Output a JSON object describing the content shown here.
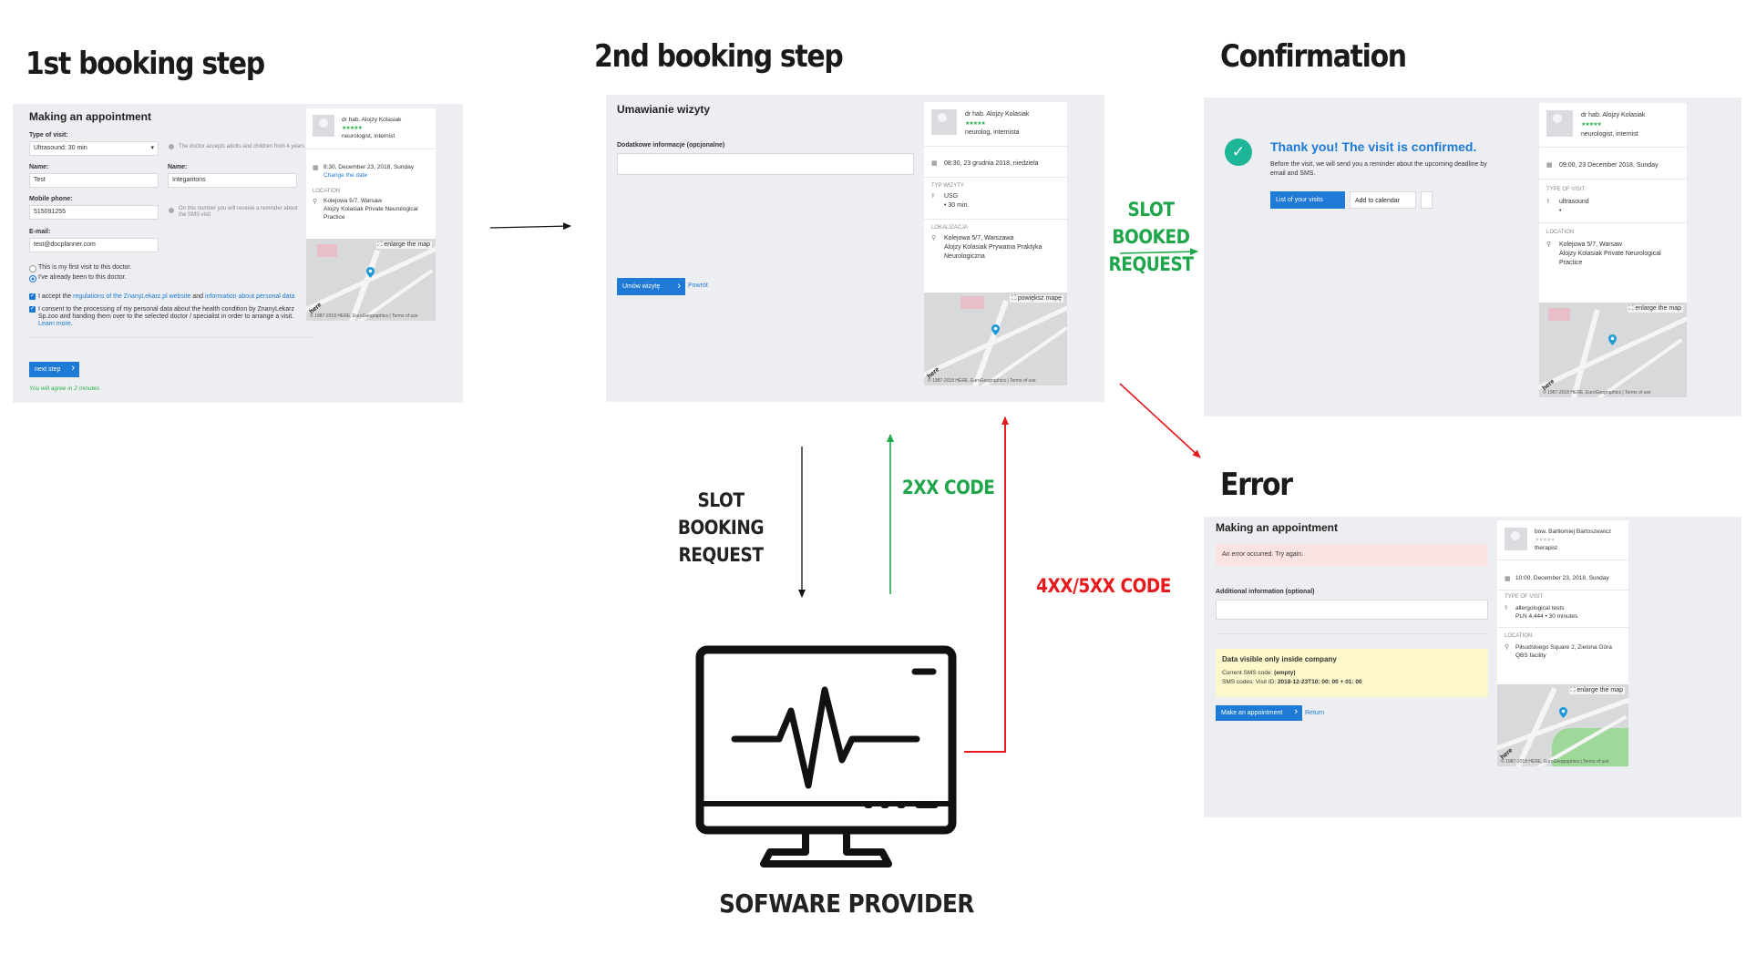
{
  "titles": {
    "step1": "1st booking step",
    "step2": "2nd booking step",
    "confirmation": "Confirmation",
    "error": "Error"
  },
  "flow": {
    "slot_booking_request": "SLOT BOOKING\nREQUEST",
    "code_2xx": "2XX CODE",
    "code_4xx_5xx": "4XX/5XX CODE",
    "slot_booked_request": "SLOT BOOKED\nREQUEST",
    "software_provider": "SOFWARE PROVIDER",
    "colors": {
      "green": "#1fa64a",
      "red": "#e8191c",
      "black": "#111111"
    }
  },
  "step1": {
    "heading": "Making an appointment",
    "type_label": "Type of visit:",
    "type_value": "Ultrasound: 30 min",
    "type_note": "The doctor accepts adults and children from 4 years",
    "name_label": "Name:",
    "name_value": "Test",
    "surname_label": "Name:",
    "surname_value": "Integaritons",
    "phone_label": "Mobile phone:",
    "phone_value": "515091255",
    "phone_note": "On this number you will receive a reminder about the SMS visit",
    "email_label": "E-mail:",
    "email_value": "test@docplanner.com",
    "first_visit": "This is my first visit to this doctor.",
    "been_before": "I've already been to this doctor.",
    "accept_prefix": "I accept the",
    "accept_link1": "regulations of the ZnanyLekarz.pl website",
    "accept_and": "and",
    "accept_link2": "information about personal data",
    "consent": "I consent to the processing of my personal data about the health condition by ZnanyLekarz",
    "consent2": "Sp.zoo and handing them over to the selected doctor / specialist in order to arrange a visit.",
    "learn_more": "Learn more.",
    "next_button": "next step",
    "agree_time": "You will agree in 2 minutes",
    "doctor_name": "dr hab. Alojzy Kolasiak",
    "doctor_stars": "★★★★★",
    "doctor_spec": "neurologist, internist",
    "date": "8:30, December 23, 2018, Sunday",
    "change_date": "Change the date",
    "location_label": "LOCATION",
    "address1": "Kolejowa 5/7, Warsaw",
    "address2": "Alojzy Kolasiak Private Neurological",
    "address3": "Practice",
    "enlarge_map": "enlarge the map",
    "map_caption": "© 1987-2018 HERE, EuroGeographics | Terms of use"
  },
  "step2": {
    "heading": "Umawianie wizyty",
    "info_label": "Dodatkowe informacje (opcjonalne)",
    "book_button": "Umów wizytę",
    "back_link": "Powrót",
    "doctor_name": "dr hab. Alojzy Kolasiak",
    "doctor_stars": "★★★★★",
    "doctor_spec": "neurolog, internista",
    "date": "08:30, 23 grudnia 2018, niedziela",
    "type_label": "TYP WIZYTY",
    "type_value": "USG",
    "type_duration": "• 30 min.",
    "location_label": "LOKALIZACJA",
    "address1": "Kolejowa 5/7, Warszawa",
    "address2": "Alojzy Kolasiak Prywatna Praktyka",
    "address3": "Neurologiczna",
    "enlarge_map": "powiększ mapę",
    "map_caption": "© 1987-2018 HERE, EuroGeographics | Terms of use"
  },
  "confirm": {
    "headline": "Thank you! The visit is confirmed.",
    "body1": "Before the visit, we will send you a reminder about the upcoming deadline by",
    "body2": "email and SMS.",
    "list_button": "List of your visits",
    "calendar_button": "Add to calendar",
    "doctor_name": "dr hab. Alojzy Kolasiak",
    "doctor_stars": "★★★★★",
    "doctor_spec": "neurologist, internist",
    "date": "09:00, 23 December 2018, Sunday",
    "type_label": "TYPE OF VISIT",
    "type_value": "ultrasound",
    "type_dot": "•",
    "location_label": "LOCATION",
    "address1": "Kolejowa 5/7, Warsaw",
    "address2": "Alojzy Kolasiak Private Neurological",
    "address3": "Practice",
    "enlarge_map": "enlarge the map",
    "map_caption": "© 1987-2018 HERE, EuroGeographics | Terms of use"
  },
  "error": {
    "heading": "Making an appointment",
    "alert": "An error occurred. Try again.",
    "info_label": "Additional information (optional)",
    "company_title": "Data visible only inside company",
    "sms_code_label": "Current SMS code:",
    "sms_code_value": "(empty)",
    "sms_codes_label": "SMS codes: Visit ID:",
    "sms_codes_value": "2018-12-23T10: 00: 00 + 01: 00",
    "make_button": "Make an appointment",
    "return_link": "Return",
    "doctor_name": "bow. Bartłomiej Bartoszewicz",
    "doctor_stars": "★★★★★",
    "doctor_spec": "therapist",
    "date": "10:00, December 23, 2018, Sunday",
    "type_label": "TYPE OF VISIT",
    "type_value": "allergological tests",
    "type_price": "PLN 4,444 • 30 minutes",
    "location_label": "LOCATION",
    "address1": "Piłsudskiego Square 2, Zielona Góra",
    "address2": "QBS facility",
    "enlarge_map": "enlarge the map",
    "map_caption": "© 1987-2018 HERE, EuroGeographics | Terms of use"
  }
}
